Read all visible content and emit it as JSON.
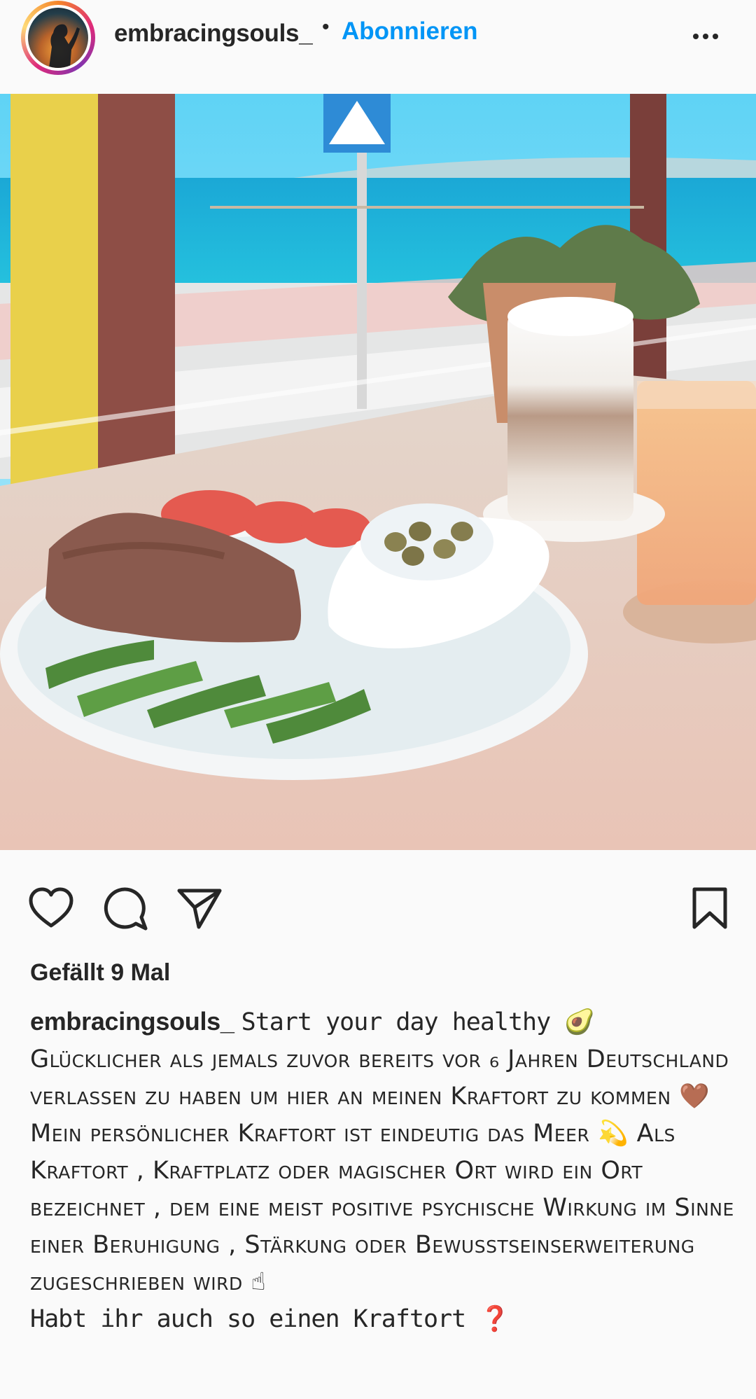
{
  "post": {
    "username": "embracingsouls_",
    "separator": "•",
    "follow_label": "Abonnieren",
    "likes_text": "Gefällt 9 Mal",
    "caption": {
      "username": "embracingsouls_",
      "line1": "Start your day healthy 🥑",
      "para1": "Glücklicher als jemals zuvor bereits vor ₆ Jahren Deutschland verlassen zu haben um hier an meinen Kraftort zu kommen 🤎",
      "para2": "Mein persönlicher Kraftort ist eindeutig das Meer 💫 Als Kraftort , Kraftplatz oder magischer Ort wird ein Ort bezeichnet , dem eine meist positive psychische Wirkung im Sinne einer Beruhigung , Stärkung oder Bewusstseinserweiterung zugeschrieben wird ☝",
      "last_line": "Habt ihr auch so einen Kraftort ❓"
    }
  },
  "icons": {
    "more": "more-options-icon",
    "like": "heart-icon",
    "comment": "comment-icon",
    "share": "send-icon",
    "save": "bookmark-icon"
  },
  "colors": {
    "accent": "#0095f6",
    "text": "#262626",
    "background": "#fafafa"
  }
}
